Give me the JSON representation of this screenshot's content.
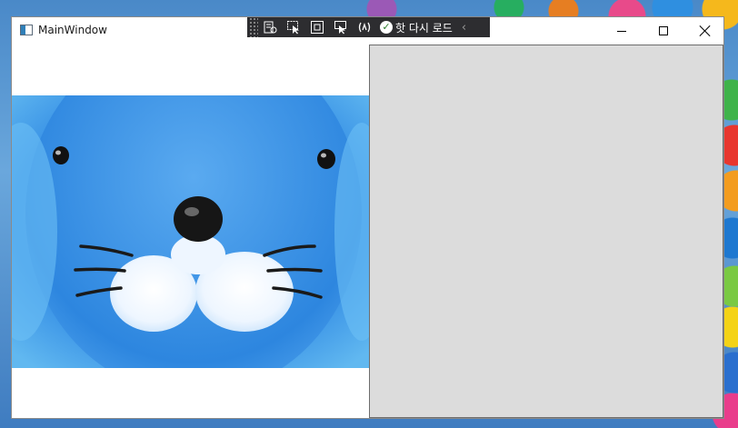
{
  "window": {
    "title": "MainWindow",
    "icon": "app-window-icon"
  },
  "caption_buttons": {
    "minimize_icon": "minimize-icon",
    "maximize_icon": "maximize-icon",
    "close_icon": "close-icon"
  },
  "dev_toolbar": {
    "items": [
      "live-visual-tree-icon",
      "select-element-icon",
      "display-layout-adorners-icon",
      "track-focus-icon",
      "binding-failures-icon"
    ],
    "hot_reload_label": "핫 다시 로드",
    "hot_reload_status": "success"
  },
  "image": {
    "subject": "blue seal face",
    "background_color": "#3e9ae8"
  },
  "panel": {
    "background_color": "#dcdcdc"
  }
}
